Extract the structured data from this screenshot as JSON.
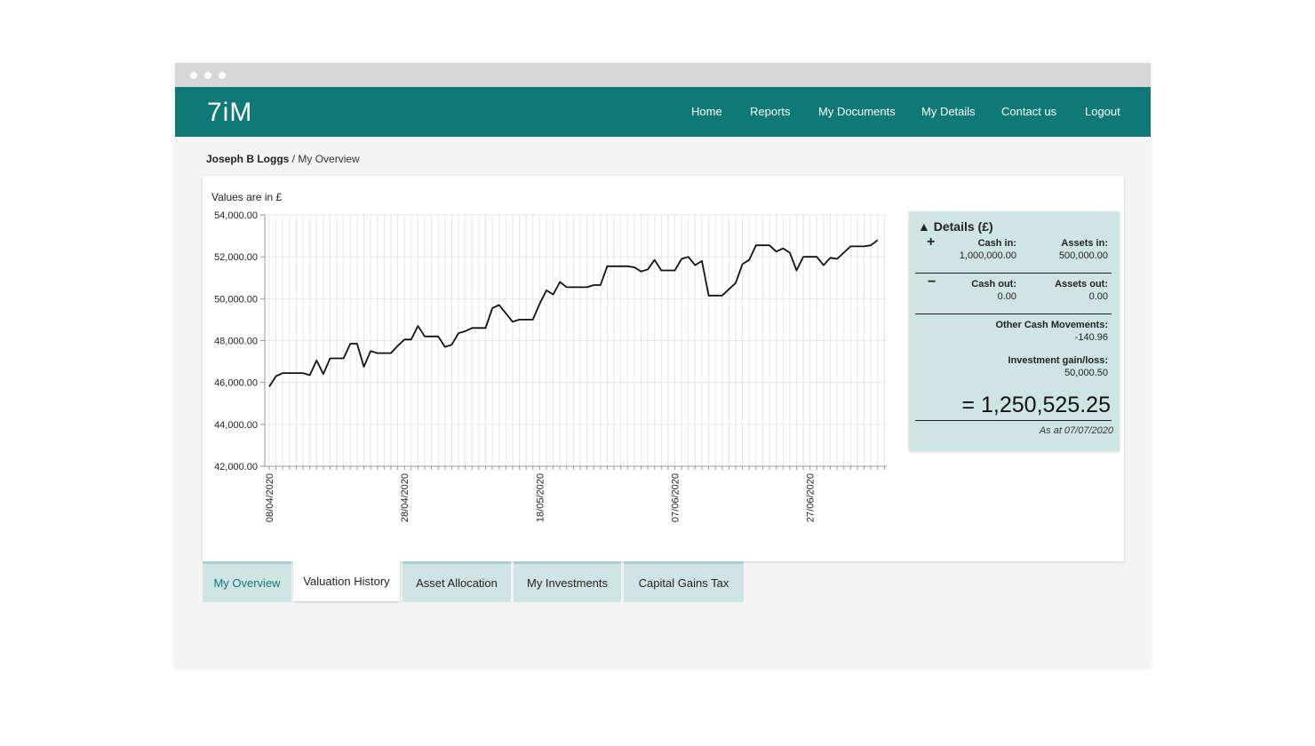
{
  "header": {
    "logo": "7iM",
    "nav": [
      "Home",
      "Reports",
      "My Documents",
      "My Details",
      "Contact us",
      "Logout"
    ]
  },
  "breadcrumb": {
    "user": "Joseph B Loggs",
    "separator": " / ",
    "page": "My Overview"
  },
  "chart": {
    "note": "Values are in £"
  },
  "chart_data": {
    "type": "line",
    "title": "",
    "xlabel": "",
    "ylabel": "",
    "ylim": [
      42000,
      54000
    ],
    "y_ticks": [
      "42,000.00",
      "44,000.00",
      "46,000.00",
      "48,000.00",
      "50,000.00",
      "52,000.00",
      "54,000.00"
    ],
    "x_ticks": [
      "08/04/2020",
      "28/04/2020",
      "18/05/2020",
      "07/06/2020",
      "27/06/2020"
    ],
    "grid": true,
    "series": [
      {
        "values": [
          45800,
          46300,
          46450,
          46450,
          46450,
          46450,
          46350,
          47050,
          46400,
          47150,
          47150,
          47150,
          47850,
          47850,
          46750,
          47500,
          47400,
          47400,
          47400,
          47750,
          48050,
          48050,
          48700,
          48200,
          48200,
          48200,
          47700,
          47800,
          48350,
          48450,
          48600,
          48600,
          48600,
          49550,
          49700,
          49300,
          48900,
          49000,
          49000,
          49000,
          49750,
          50400,
          50200,
          50800,
          50550,
          50550,
          50550,
          50550,
          50650,
          50650,
          51550,
          51550,
          51550,
          51550,
          51500,
          51300,
          51400,
          51850,
          51350,
          51350,
          51350,
          51900,
          52000,
          51600,
          51800,
          50150,
          50150,
          50150,
          50450,
          50750,
          51650,
          51850,
          52550,
          52550,
          52550,
          52250,
          52400,
          52200,
          51350,
          52000,
          52000,
          52000,
          51600,
          51950,
          51900,
          52200,
          52500,
          52500,
          52500,
          52550,
          52800
        ]
      }
    ]
  },
  "details": {
    "title": "Details (£)",
    "toggle_icon": "triangle-up",
    "cash_in_label": "Cash in:",
    "cash_in_value": "1,000,000.00",
    "assets_in_label": "Assets in:",
    "assets_in_value": "500,000.00",
    "cash_out_label": "Cash out:",
    "cash_out_value": "0.00",
    "assets_out_label": "Assets out:",
    "assets_out_value": "0.00",
    "other_label": "Other Cash Movements:",
    "other_value": "-140.96",
    "gain_label": "Investment gain/loss:",
    "gain_value": "50,000.50",
    "total": "= 1,250,525.25",
    "as_at": "As at 07/07/2020",
    "plus": "+",
    "minus": "−"
  },
  "tabs": [
    "My Overview",
    "Valuation History",
    "Asset Allocation",
    "My Investments",
    "Capital Gains Tax"
  ],
  "colors": {
    "brand": "#0f7a75",
    "panel": "#cfe5e3"
  }
}
